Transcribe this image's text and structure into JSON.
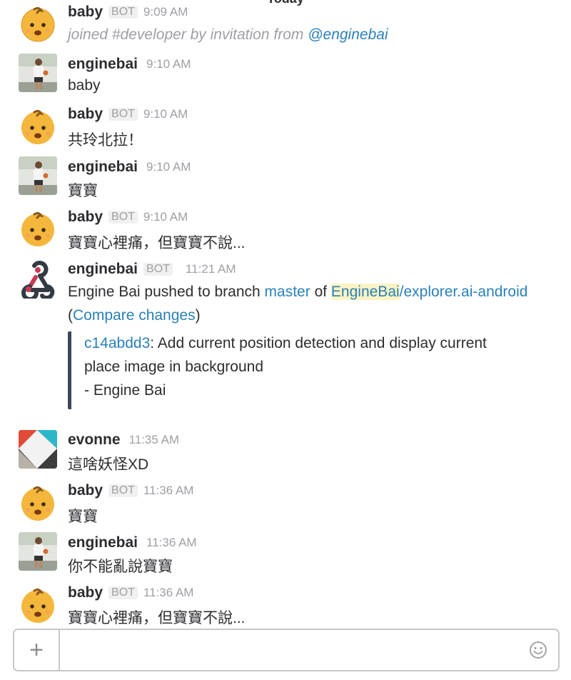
{
  "day_divider": "Today",
  "composer": {
    "plus_label": "+",
    "input_value": "",
    "input_placeholder": ""
  },
  "messages": [
    {
      "author": "baby",
      "bot_tag": "BOT",
      "time": "9:09 AM",
      "system_prefix": "joined #developer by invitation from ",
      "system_mention": "@enginebai"
    },
    {
      "author": "enginebai",
      "time": "9:10 AM",
      "text": "baby"
    },
    {
      "author": "baby",
      "bot_tag": "BOT",
      "time": "9:10 AM",
      "text": "共玲北拉！"
    },
    {
      "author": "enginebai",
      "time": "9:10 AM",
      "text": "寶寶"
    },
    {
      "author": "baby",
      "bot_tag": "BOT",
      "time": "9:10 AM",
      "text": "寶寶心裡痛，但寶寶不說..."
    },
    {
      "author": "enginebai",
      "bot_tag": "BOT",
      "time": "11:21 AM",
      "push_prefix": "Engine Bai pushed to branch ",
      "branch": "master",
      "of_word": " of ",
      "repo_owner": "EngineBai",
      "repo_rest": "/explorer.ai-android",
      "paren_open": "(",
      "compare_link": "Compare changes",
      "paren_close": ")",
      "commit_hash": "c14abdd3",
      "commit_msg_line1": ": Add current position detection and display current",
      "commit_msg_line2": "place image in background",
      "commit_author": "- Engine Bai"
    },
    {
      "author": "evonne",
      "time": "11:35 AM",
      "text": "這啥妖怪XD"
    },
    {
      "author": "baby",
      "bot_tag": "BOT",
      "time": "11:36 AM",
      "text": "寶寶"
    },
    {
      "author": "enginebai",
      "time": "11:36 AM",
      "text": "你不能亂說寶寶"
    },
    {
      "author": "baby",
      "bot_tag": "BOT",
      "time": "11:36 AM",
      "text": "寶寶心裡痛，但寶寶不說..."
    }
  ]
}
